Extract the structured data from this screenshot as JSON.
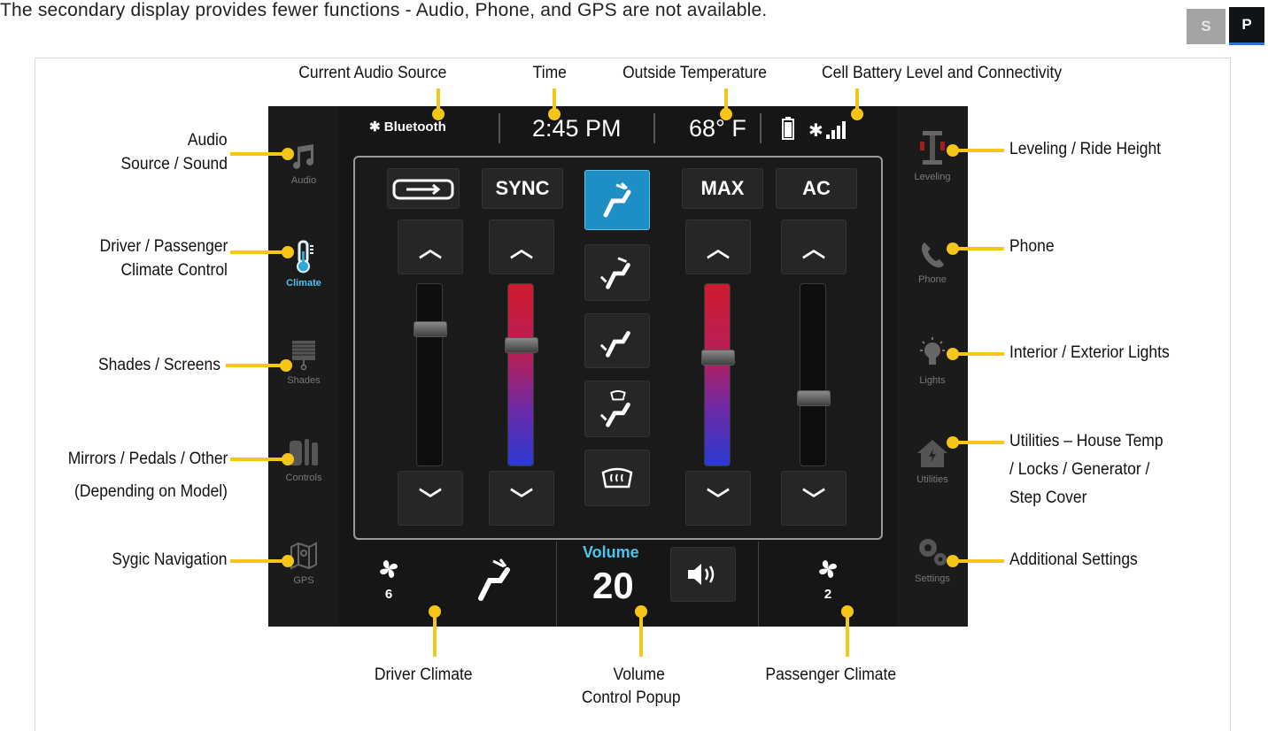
{
  "caption": "The secondary display provides fewer functions - Audio, Phone, and GPS are not available.",
  "toggles": {
    "s": "S",
    "p": "P"
  },
  "labels": {
    "current_audio_source": "Current Audio Source",
    "time": "Time",
    "outside_temperature": "Outside Temperature",
    "cell_battery": "Cell Battery Level and Connectivity",
    "audio_source_l1": "Audio",
    "audio_source_l2": "Source / Sound",
    "climate_l1": "Driver / Passenger",
    "climate_l2": "Climate Control",
    "shades": "Shades / Screens",
    "mirrors_l1": "Mirrors / Pedals / Other",
    "mirrors_l2": "(Depending on Model)",
    "sygic": "Sygic Navigation",
    "leveling": "Leveling / Ride Height",
    "phone": "Phone",
    "lights": "Interior / Exterior Lights",
    "utilities_l1": "Utilities – House Temp",
    "utilities_l2": "/ Locks / Generator /",
    "utilities_l3": "Step Cover",
    "settings": "Additional Settings",
    "driver_climate": "Driver Climate",
    "volume_l1": "Volume",
    "volume_l2": "Control Popup",
    "passenger_climate": "Passenger Climate"
  },
  "screen": {
    "left_nav": [
      {
        "label": "Audio",
        "icon": "music-note-icon"
      },
      {
        "label": "Climate",
        "icon": "thermometer-icon",
        "active": true
      },
      {
        "label": "Shades",
        "icon": "shades-icon"
      },
      {
        "label": "Controls",
        "icon": "controls-icon"
      },
      {
        "label": "GPS",
        "icon": "map-icon"
      }
    ],
    "right_nav": [
      {
        "label": "Leveling",
        "icon": "leveling-icon"
      },
      {
        "label": "Phone",
        "icon": "phone-icon"
      },
      {
        "label": "Lights",
        "icon": "bulb-icon"
      },
      {
        "label": "Utilities",
        "icon": "house-icon"
      },
      {
        "label": "Settings",
        "icon": "gears-icon"
      }
    ],
    "topbar": {
      "audio_source": "Bluetooth",
      "time": "2:45 PM",
      "temperature": "68° F"
    },
    "panel": {
      "sync": "SYNC",
      "max": "MAX",
      "ac": "AC"
    },
    "bottombar": {
      "driver_fan": "6",
      "volume_label": "Volume",
      "volume_value": "20",
      "passenger_fan": "2"
    },
    "colors": {
      "accent": "#2fa8d8",
      "callout": "#f5c518",
      "heat": "#e0203a",
      "cool": "#2a3ad0"
    }
  }
}
